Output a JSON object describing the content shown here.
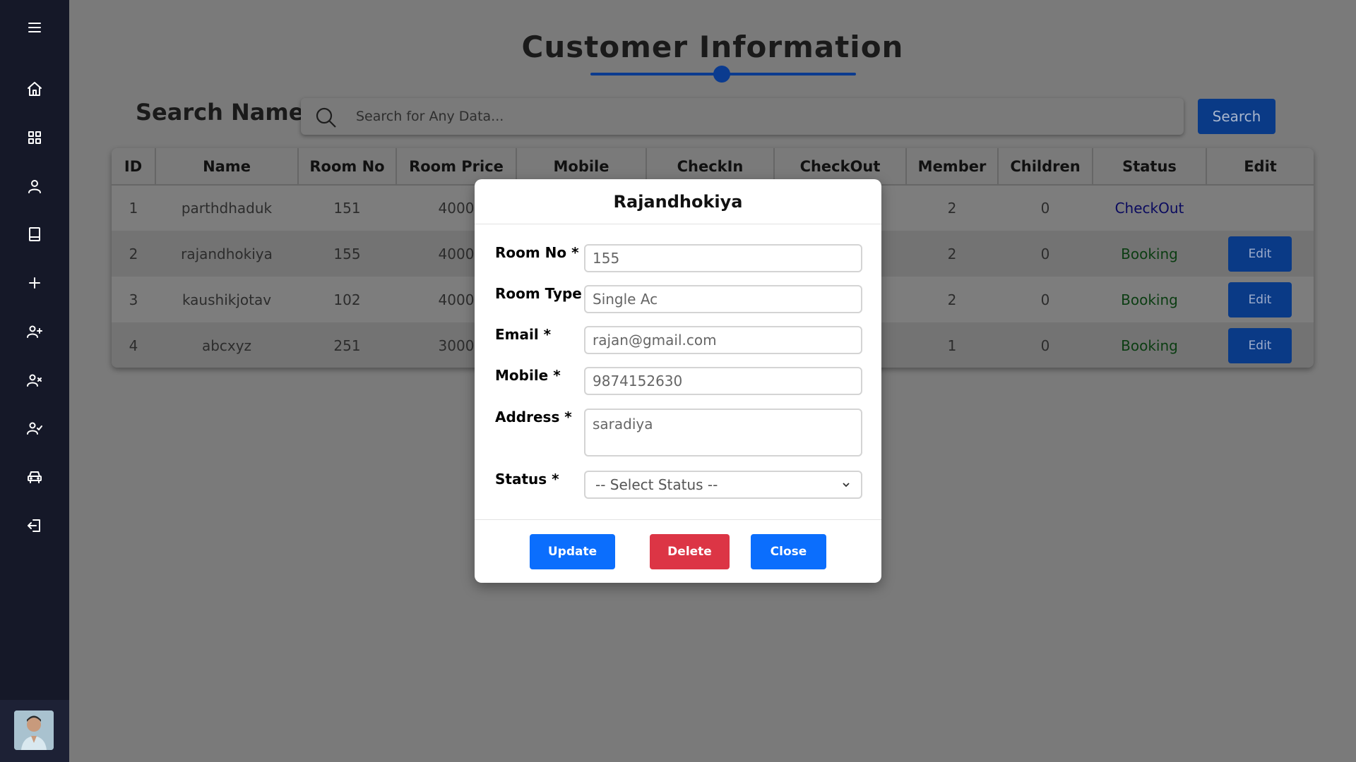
{
  "sidebar": {
    "icons": [
      "menu-icon",
      "home-icon",
      "dashboard-icon",
      "user-icon",
      "book-icon",
      "plus-icon",
      "user-add-icon",
      "user-remove-icon",
      "user-check-icon",
      "car-icon",
      "logout-icon"
    ]
  },
  "page": {
    "title": "Customer Information"
  },
  "search": {
    "label": "Search Name",
    "placeholder": "Search for Any Data...",
    "button_label": "Search"
  },
  "table": {
    "headers": [
      "ID",
      "Name",
      "Room No",
      "Room Price",
      "Mobile",
      "CheckIn",
      "CheckOut",
      "Member",
      "Children",
      "Status",
      "Edit"
    ],
    "rows": [
      {
        "id": "1",
        "name": "parthdhaduk",
        "room_no": "151",
        "room_price": "4000",
        "member": "2",
        "children": "0",
        "status": "CheckOut",
        "edit": ""
      },
      {
        "id": "2",
        "name": "rajandhokiya",
        "room_no": "155",
        "room_price": "4000",
        "member": "2",
        "children": "0",
        "status": "Booking",
        "edit": "Edit"
      },
      {
        "id": "3",
        "name": "kaushikjotav",
        "room_no": "102",
        "room_price": "4000",
        "member": "2",
        "children": "0",
        "status": "Booking",
        "edit": "Edit"
      },
      {
        "id": "4",
        "name": "abcxyz",
        "room_no": "251",
        "room_price": "3000",
        "member": "1",
        "children": "0",
        "status": "Booking",
        "edit": "Edit"
      }
    ]
  },
  "modal": {
    "title": "Rajandhokiya",
    "fields": {
      "room_no": {
        "label": "Room No *",
        "value": "155"
      },
      "room_type": {
        "label": "Room Type *",
        "value": "Single Ac"
      },
      "email": {
        "label": "Email *",
        "value": "rajan@gmail.com"
      },
      "mobile": {
        "label": "Mobile *",
        "value": "9874152630"
      },
      "address": {
        "label": "Address *",
        "value": "saradiya"
      },
      "status": {
        "label": "Status *",
        "value": "-- Select Status --"
      }
    },
    "buttons": {
      "update": "Update",
      "delete": "Delete",
      "close": "Close"
    }
  },
  "colors": {
    "sidebar_bg": "#151828",
    "primary": "#0b6efd",
    "danger": "#dc3545",
    "dark_blue": "#0a3a86"
  }
}
